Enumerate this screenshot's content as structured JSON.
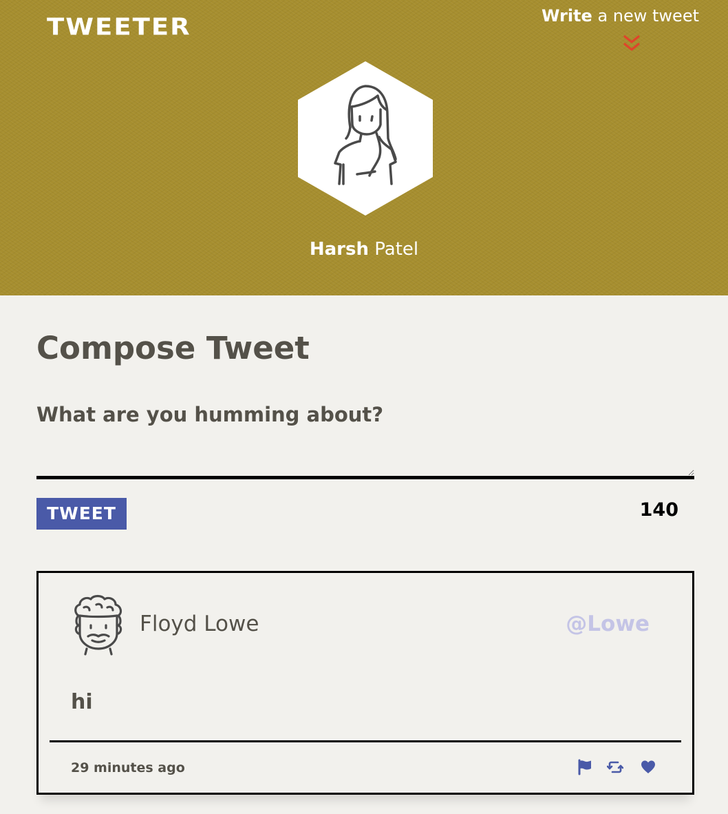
{
  "header": {
    "logo": "TWEETER",
    "write_link": {
      "bold": "Write",
      "rest": " a new tweet"
    },
    "chevron_icon": "double-chevron-down-icon",
    "chevron_color": "#e0442a",
    "profile": {
      "first_name": "Harsh",
      "last_name": " Patel",
      "avatar_icon": "woman-avatar-icon"
    },
    "background_color": "#a68e2f"
  },
  "compose": {
    "title": "Compose Tweet",
    "label": "What are you humming about?",
    "textarea_value": "",
    "button_label": "TWEET",
    "char_count": "140",
    "button_color": "#4a5aa8"
  },
  "tweets": [
    {
      "avatar_icon": "curly-haired-man-avatar-icon",
      "author": "Floyd Lowe",
      "handle": "@Lowe",
      "content": "hi",
      "timestamp": "29 minutes ago",
      "actions": [
        "flag-icon",
        "retweet-icon",
        "heart-icon"
      ],
      "action_color": "#4a5aa8",
      "handle_color": "#c4c4e6"
    }
  ]
}
